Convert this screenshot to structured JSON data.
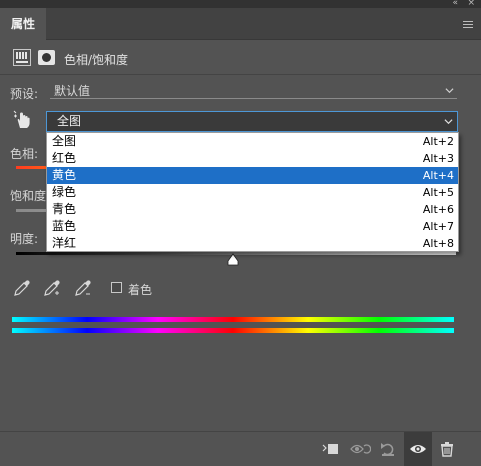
{
  "panel": {
    "tab_label": "属性",
    "collapse_glyph": "«",
    "close_glyph": "×"
  },
  "header": {
    "title": "色相/饱和度"
  },
  "preset": {
    "label": "预设:",
    "value": "默认值"
  },
  "range": {
    "value": "全图"
  },
  "dropdown": {
    "items": [
      {
        "label": "全图",
        "shortcut": "Alt+2"
      },
      {
        "label": "红色",
        "shortcut": "Alt+3"
      },
      {
        "label": "黄色",
        "shortcut": "Alt+4",
        "selected": true
      },
      {
        "label": "绿色",
        "shortcut": "Alt+5"
      },
      {
        "label": "青色",
        "shortcut": "Alt+6"
      },
      {
        "label": "蓝色",
        "shortcut": "Alt+7"
      },
      {
        "label": "洋红",
        "shortcut": "Alt+8"
      }
    ]
  },
  "sliders": {
    "hue_label": "色相:",
    "saturation_label": "饱和度",
    "lightness_label": "明度:"
  },
  "colorize": {
    "label": "着色",
    "checked": false
  },
  "icons": {
    "toolbar": [
      "eyedropper-icon",
      "eyedropper-plus-icon",
      "eyedropper-minus-icon"
    ],
    "bottom": [
      "clip-to-layer-icon",
      "view-previous-state-icon",
      "reset-icon",
      "visibility-eye-icon",
      "delete-trash-icon"
    ]
  },
  "colors": {
    "panel_bg": "#535353",
    "selection": "#1e6fc7",
    "focus_border": "#4d97d6"
  }
}
